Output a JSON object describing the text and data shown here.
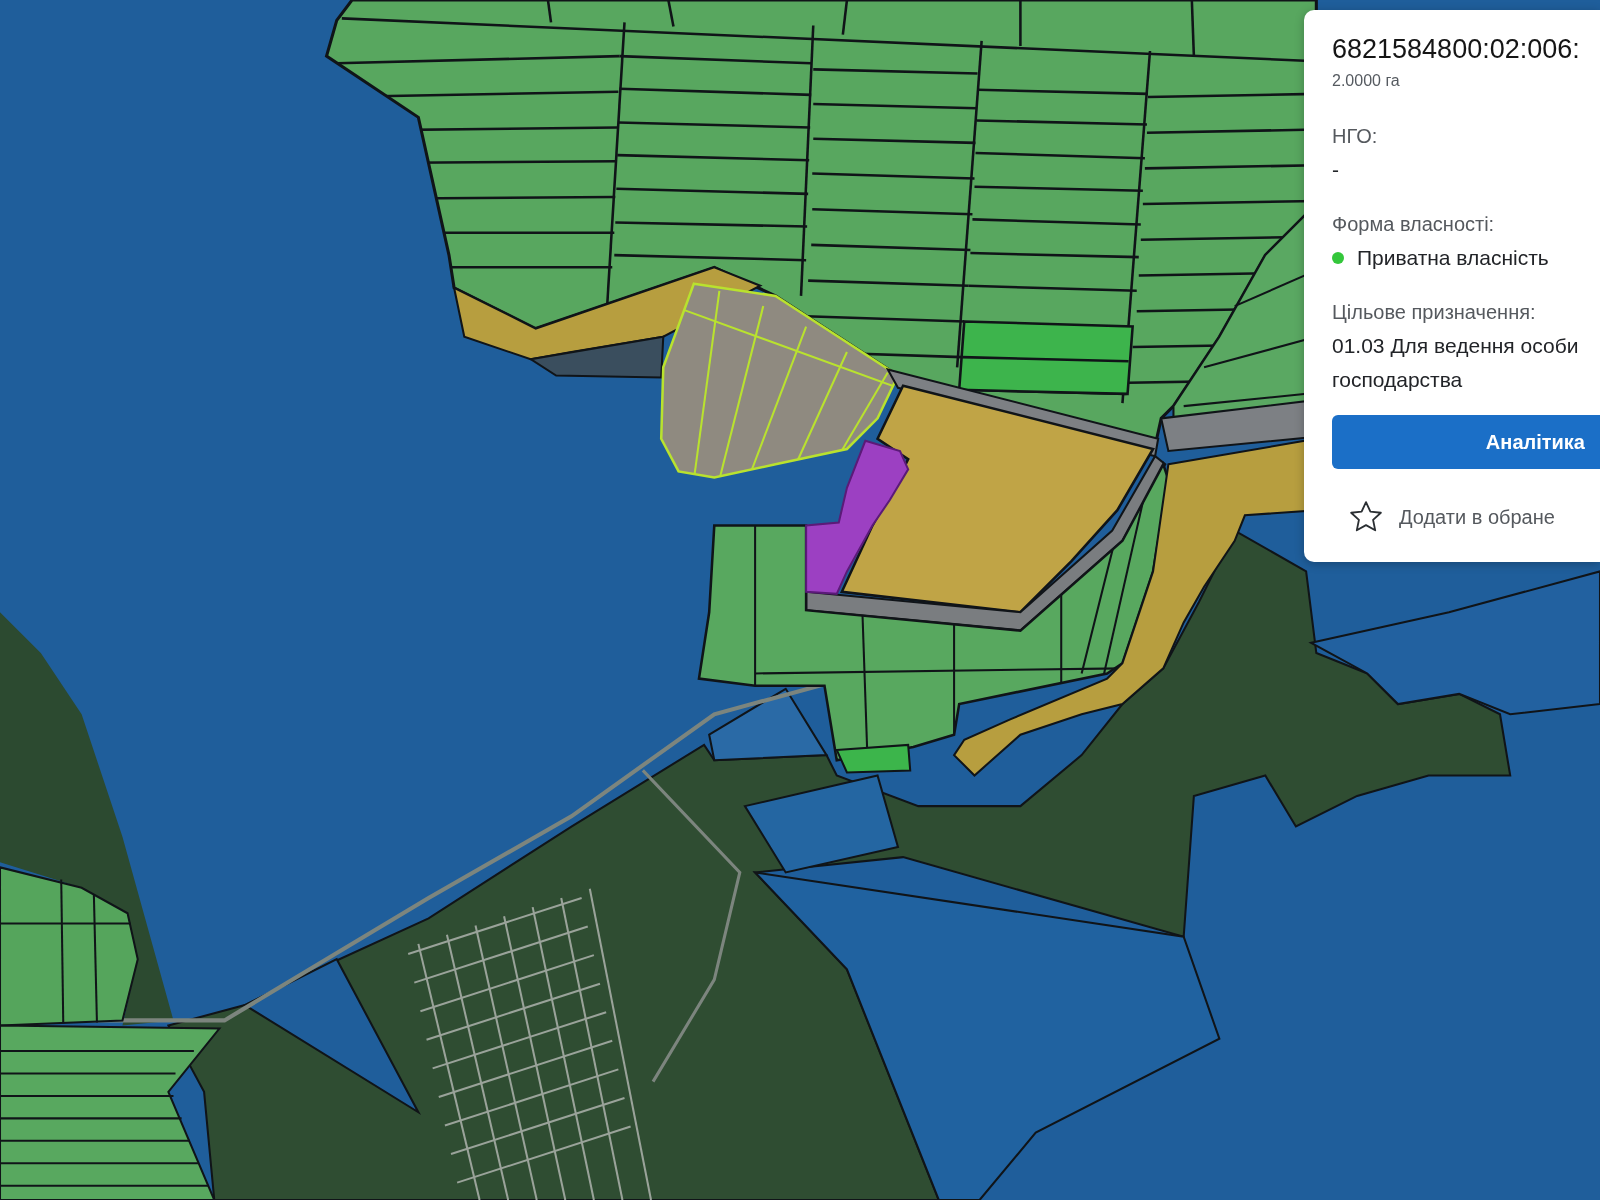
{
  "parcel_card": {
    "cadastral_number": "6821584800:02:006:",
    "area": "2.0000 га",
    "fields": [
      {
        "label": "НГО:",
        "value_lines": [
          "-"
        ]
      },
      {
        "label": "Форма власності:",
        "value_lines": [
          "Приватна власність"
        ],
        "color": "#34c73b"
      },
      {
        "label": "Цільове призначення:",
        "value_lines": [
          "01.03 Для ведення особи",
          "господарства"
        ]
      }
    ],
    "analytics_button": {
      "label": "Аналітика"
    },
    "favorite": {
      "label": "Додати в обране",
      "selected": false
    }
  }
}
